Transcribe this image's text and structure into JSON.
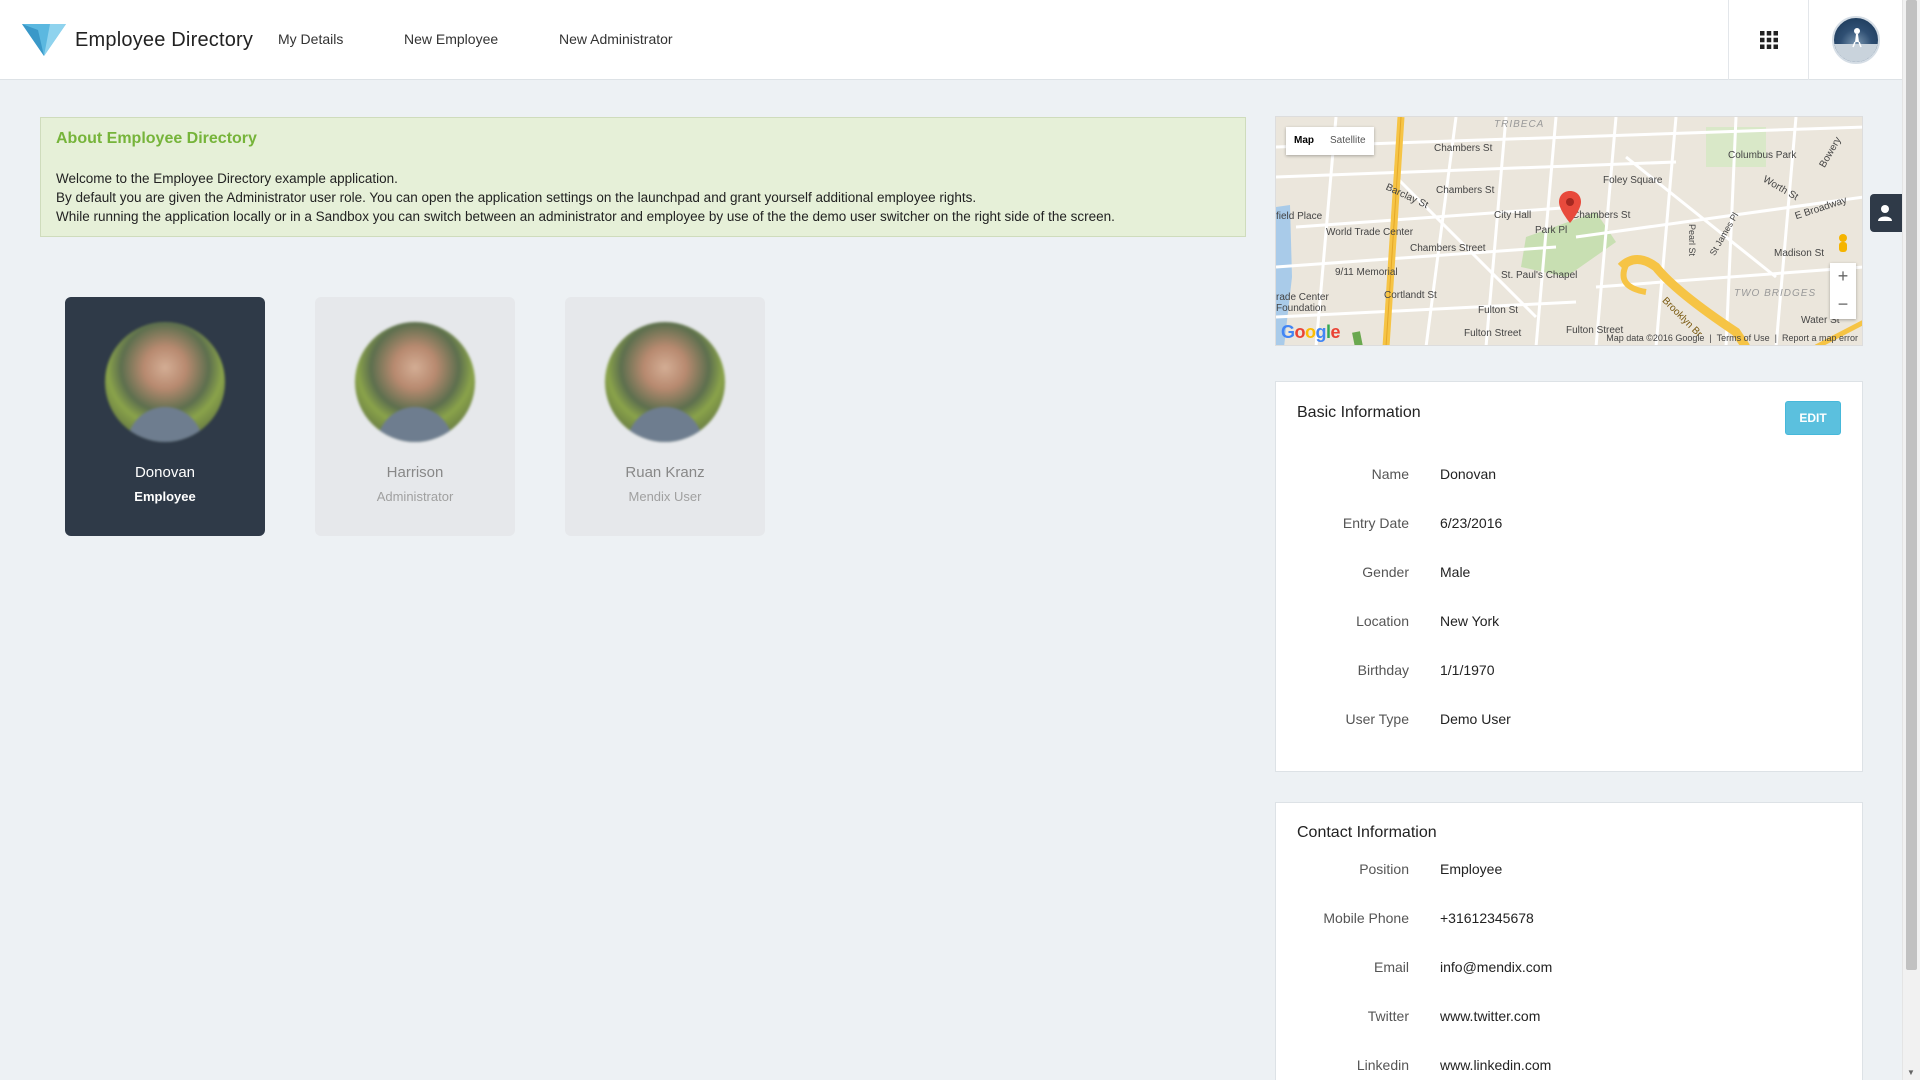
{
  "header": {
    "app_title": "Employee Directory",
    "nav": [
      "My Details",
      "New Employee",
      "New Administrator"
    ],
    "apps_icon": "grid-icon",
    "avatar_icon": "user-avatar"
  },
  "about": {
    "title": "About Employee Directory",
    "lines": [
      "Welcome to the Employee Directory example application.",
      "By default you are given the Administrator user role. You can open the application settings on the launchpad and grant yourself additional employee rights.",
      "While running the application locally or in a Sandbox you can switch between an administrator and employee by use of the the demo user switcher on the right side of the screen."
    ]
  },
  "users": [
    {
      "name": "Donovan",
      "role": "Employee",
      "selected": true
    },
    {
      "name": "Harrison",
      "role": "Administrator",
      "selected": false
    },
    {
      "name": "Ruan Kranz",
      "role": "Mendix User",
      "selected": false
    }
  ],
  "map": {
    "type_map": "Map",
    "type_satellite": "Satellite",
    "labels": [
      "TRIBECA",
      "Chambers St",
      "Chambers St",
      "Chambers St",
      "Foley Square",
      "Columbus Park",
      "Barclay St",
      "World Trade Center",
      "City Hall",
      "Park Pl",
      "Chambers Street",
      "9/11 Memorial",
      "St. Paul's Chapel",
      "Cortlandt St",
      "Fulton St",
      "Fulton Street",
      "Fulton Street",
      "Madison St",
      "E Broadway",
      "Worth St",
      "TWO BRIDGES",
      "Pearl St",
      "St James Pl",
      "Brooklyn Br",
      "Water St",
      "field Place",
      "rade Center Foundation",
      "Bowery"
    ],
    "attribution": "Map data ©2016 Google",
    "terms": "Terms of Use",
    "report": "Report a map error",
    "logo": "Google"
  },
  "basic_info": {
    "title": "Basic Information",
    "edit_label": "EDIT",
    "fields": [
      {
        "label": "Name",
        "value": "Donovan"
      },
      {
        "label": "Entry Date",
        "value": "6/23/2016"
      },
      {
        "label": "Gender",
        "value": "Male"
      },
      {
        "label": "Location",
        "value": "New York"
      },
      {
        "label": "Birthday",
        "value": "1/1/1970"
      },
      {
        "label": "User Type",
        "value": "Demo User"
      }
    ]
  },
  "contact_info": {
    "title": "Contact Information",
    "fields": [
      {
        "label": "Position",
        "value": "Employee"
      },
      {
        "label": "Mobile Phone",
        "value": "+31612345678"
      },
      {
        "label": "Email",
        "value": "info@mendix.com"
      },
      {
        "label": "Twitter",
        "value": "www.twitter.com"
      },
      {
        "label": "Linkedin",
        "value": "www.linkedin.com"
      }
    ]
  },
  "colors": {
    "accent_green": "#76b43a",
    "card_active": "#2f3a48",
    "edit_button": "#5bc0de"
  }
}
